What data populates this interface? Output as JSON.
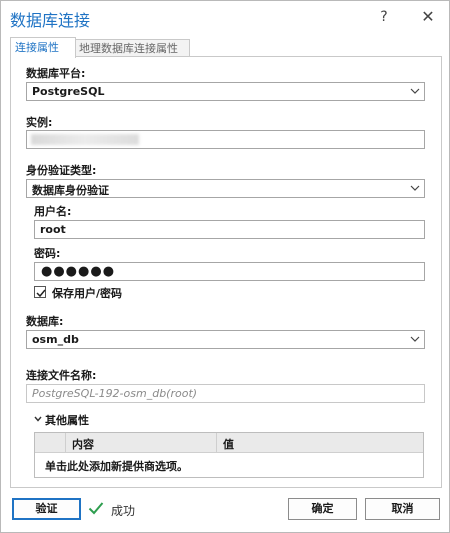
{
  "window": {
    "title": "数据库连接",
    "help_glyph": "?",
    "close_glyph": "✕"
  },
  "tabs": [
    {
      "label": "连接属性",
      "active": true
    },
    {
      "label": "地理数据库连接属性",
      "active": false
    }
  ],
  "form": {
    "platform_label": "数据库平台:",
    "platform_value": "PostgreSQL",
    "instance_label": "实例:",
    "auth_label": "身份验证类型:",
    "auth_value": "数据库身份验证",
    "username_label": "用户名:",
    "username_value": "root",
    "password_label": "密码:",
    "password_value": "●●●●●●",
    "save_credentials_label": "保存用户/密码",
    "save_credentials_checked": true,
    "database_label": "数据库:",
    "database_value": "osm_db",
    "conn_file_label": "连接文件名称:",
    "conn_file_value": "PostgreSQL-192-osm_db(root)"
  },
  "other_properties": {
    "section_label": "其他属性",
    "columns": [
      "内容",
      "值"
    ],
    "add_hint": "单击此处添加新提供商选项。"
  },
  "footer": {
    "verify_label": "验证",
    "status_text": "成功",
    "ok_label": "确定",
    "cancel_label": "取消"
  },
  "colors": {
    "accent": "#1f73c4",
    "success": "#2e9e4f"
  }
}
